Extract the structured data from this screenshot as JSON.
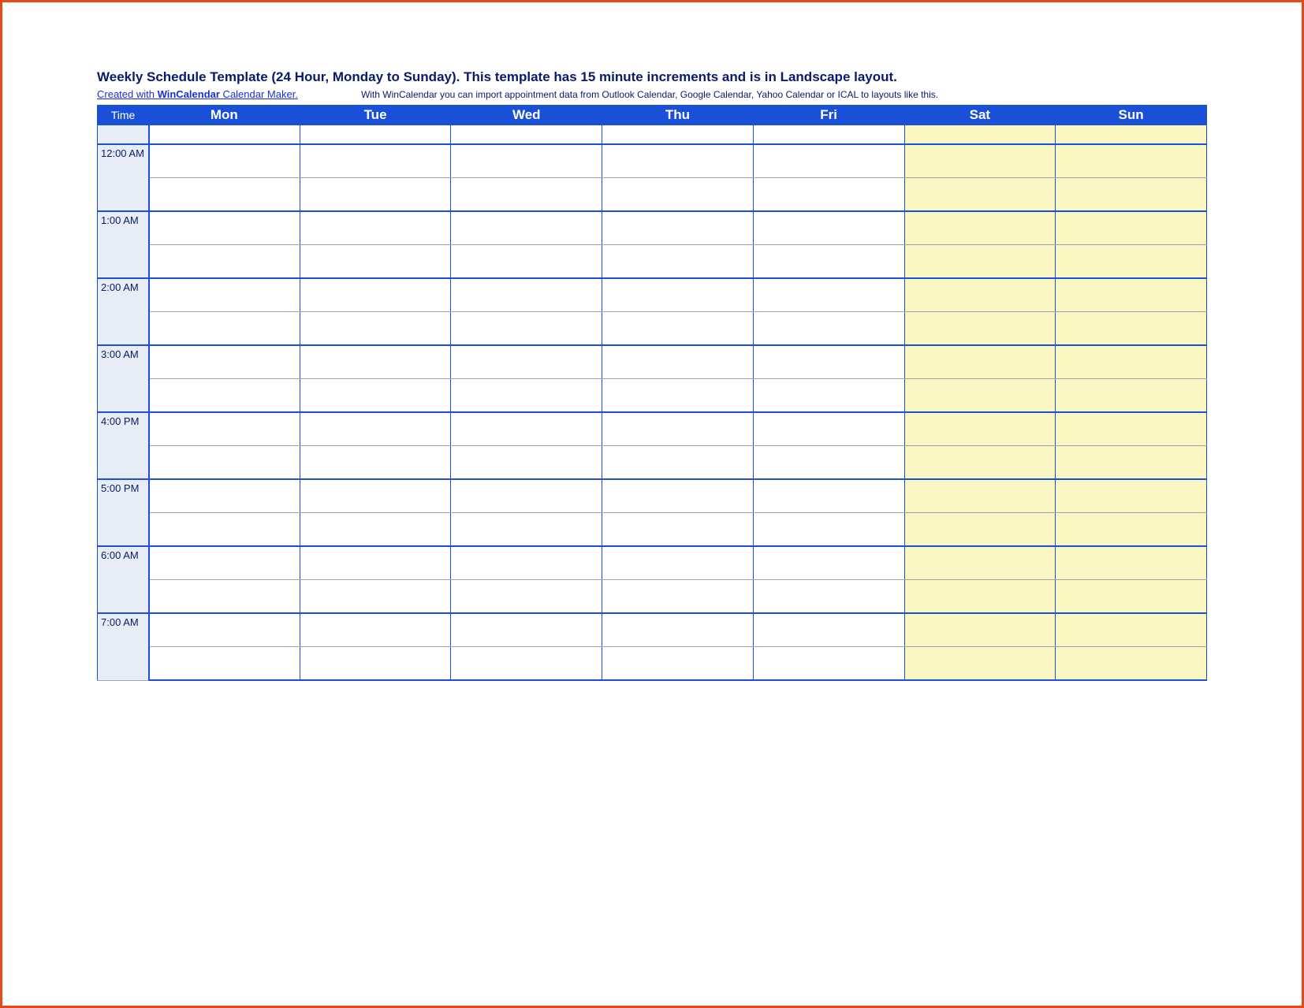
{
  "title": "Weekly Schedule Template (24 Hour, Monday to Sunday).  This template has 15 minute increments and is in Landscape layout.",
  "sub": {
    "link_prefix": "Created with ",
    "link_brand": "WinCalendar",
    "link_suffix": " Calendar Maker.",
    "note": "With WinCalendar you can import appointment data from Outlook Calendar, Google Calendar, Yahoo Calendar or ICAL to layouts like this."
  },
  "columns": {
    "time": "Time",
    "days": [
      "Mon",
      "Tue",
      "Wed",
      "Thu",
      "Fri",
      "Sat",
      "Sun"
    ]
  },
  "weekend_indices": [
    5,
    6
  ],
  "hours": [
    {
      "label": "12:00 AM"
    },
    {
      "label": "1:00 AM"
    },
    {
      "label": "2:00 AM"
    },
    {
      "label": "3:00 AM"
    },
    {
      "label": "4:00 PM"
    },
    {
      "label": "5:00 PM"
    },
    {
      "label": "6:00 AM"
    },
    {
      "label": "7:00 AM"
    }
  ]
}
